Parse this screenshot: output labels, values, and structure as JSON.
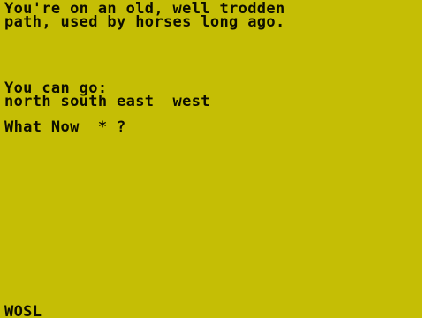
{
  "screen": {
    "background": "#c5be05",
    "text_color": "#0d0d00"
  },
  "description": {
    "line1": "You're on an old, well trodden",
    "line2": "path, used by horses long ago."
  },
  "exits": {
    "heading": "You can go:",
    "directions": "north south east  west"
  },
  "prompt": {
    "text": "What Now  * ?"
  },
  "status": {
    "text": "WOSL"
  }
}
